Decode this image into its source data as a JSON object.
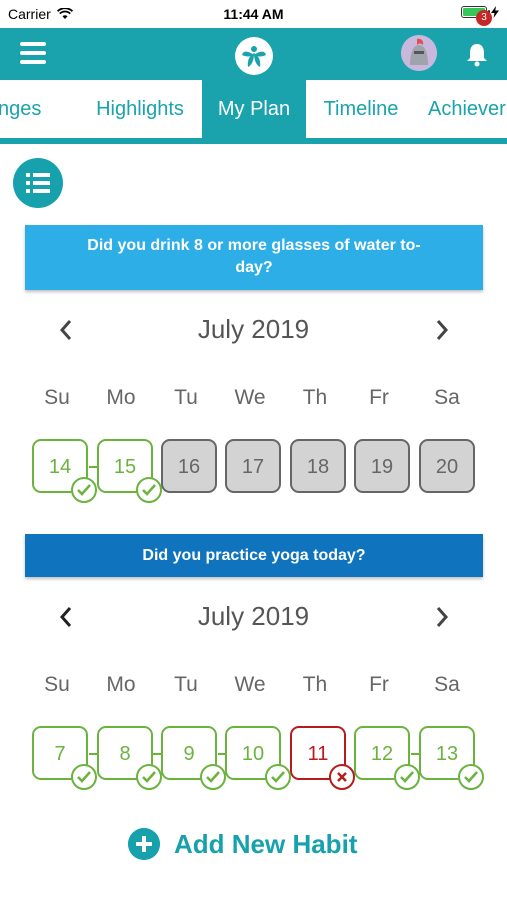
{
  "status": {
    "carrier": "Carrier",
    "time": "11:44 AM"
  },
  "header": {
    "notification_count": "3"
  },
  "tabs": [
    {
      "label": "llenges"
    },
    {
      "label": "Highlights"
    },
    {
      "label": "My Plan"
    },
    {
      "label": "Timeline"
    },
    {
      "label": "Achiever"
    }
  ],
  "habits": [
    {
      "question": "Did you drink 8 or more glasses of water to-\nday?",
      "month": "July 2019",
      "weekdays": [
        "Su",
        "Mo",
        "Tu",
        "We",
        "Th",
        "Fr",
        "Sa"
      ],
      "days": [
        {
          "num": "14",
          "state": "done"
        },
        {
          "num": "15",
          "state": "done"
        },
        {
          "num": "16",
          "state": "future"
        },
        {
          "num": "17",
          "state": "future"
        },
        {
          "num": "18",
          "state": "future"
        },
        {
          "num": "19",
          "state": "future"
        },
        {
          "num": "20",
          "state": "future"
        }
      ]
    },
    {
      "question": "Did you practice yoga today?",
      "month": "July 2019",
      "weekdays": [
        "Su",
        "Mo",
        "Tu",
        "We",
        "Th",
        "Fr",
        "Sa"
      ],
      "days": [
        {
          "num": "7",
          "state": "done"
        },
        {
          "num": "8",
          "state": "done"
        },
        {
          "num": "9",
          "state": "done"
        },
        {
          "num": "10",
          "state": "done"
        },
        {
          "num": "11",
          "state": "missed"
        },
        {
          "num": "12",
          "state": "done"
        },
        {
          "num": "13",
          "state": "done"
        }
      ]
    }
  ],
  "add_habit_label": "Add New Habit",
  "colors": {
    "teal": "#1ba3ad",
    "water_banner": "#2eaee7",
    "yoga_banner": "#0f73bd",
    "done": "#6bb33f",
    "missed": "#b71c1c",
    "future_fill": "#d3d3d3"
  }
}
